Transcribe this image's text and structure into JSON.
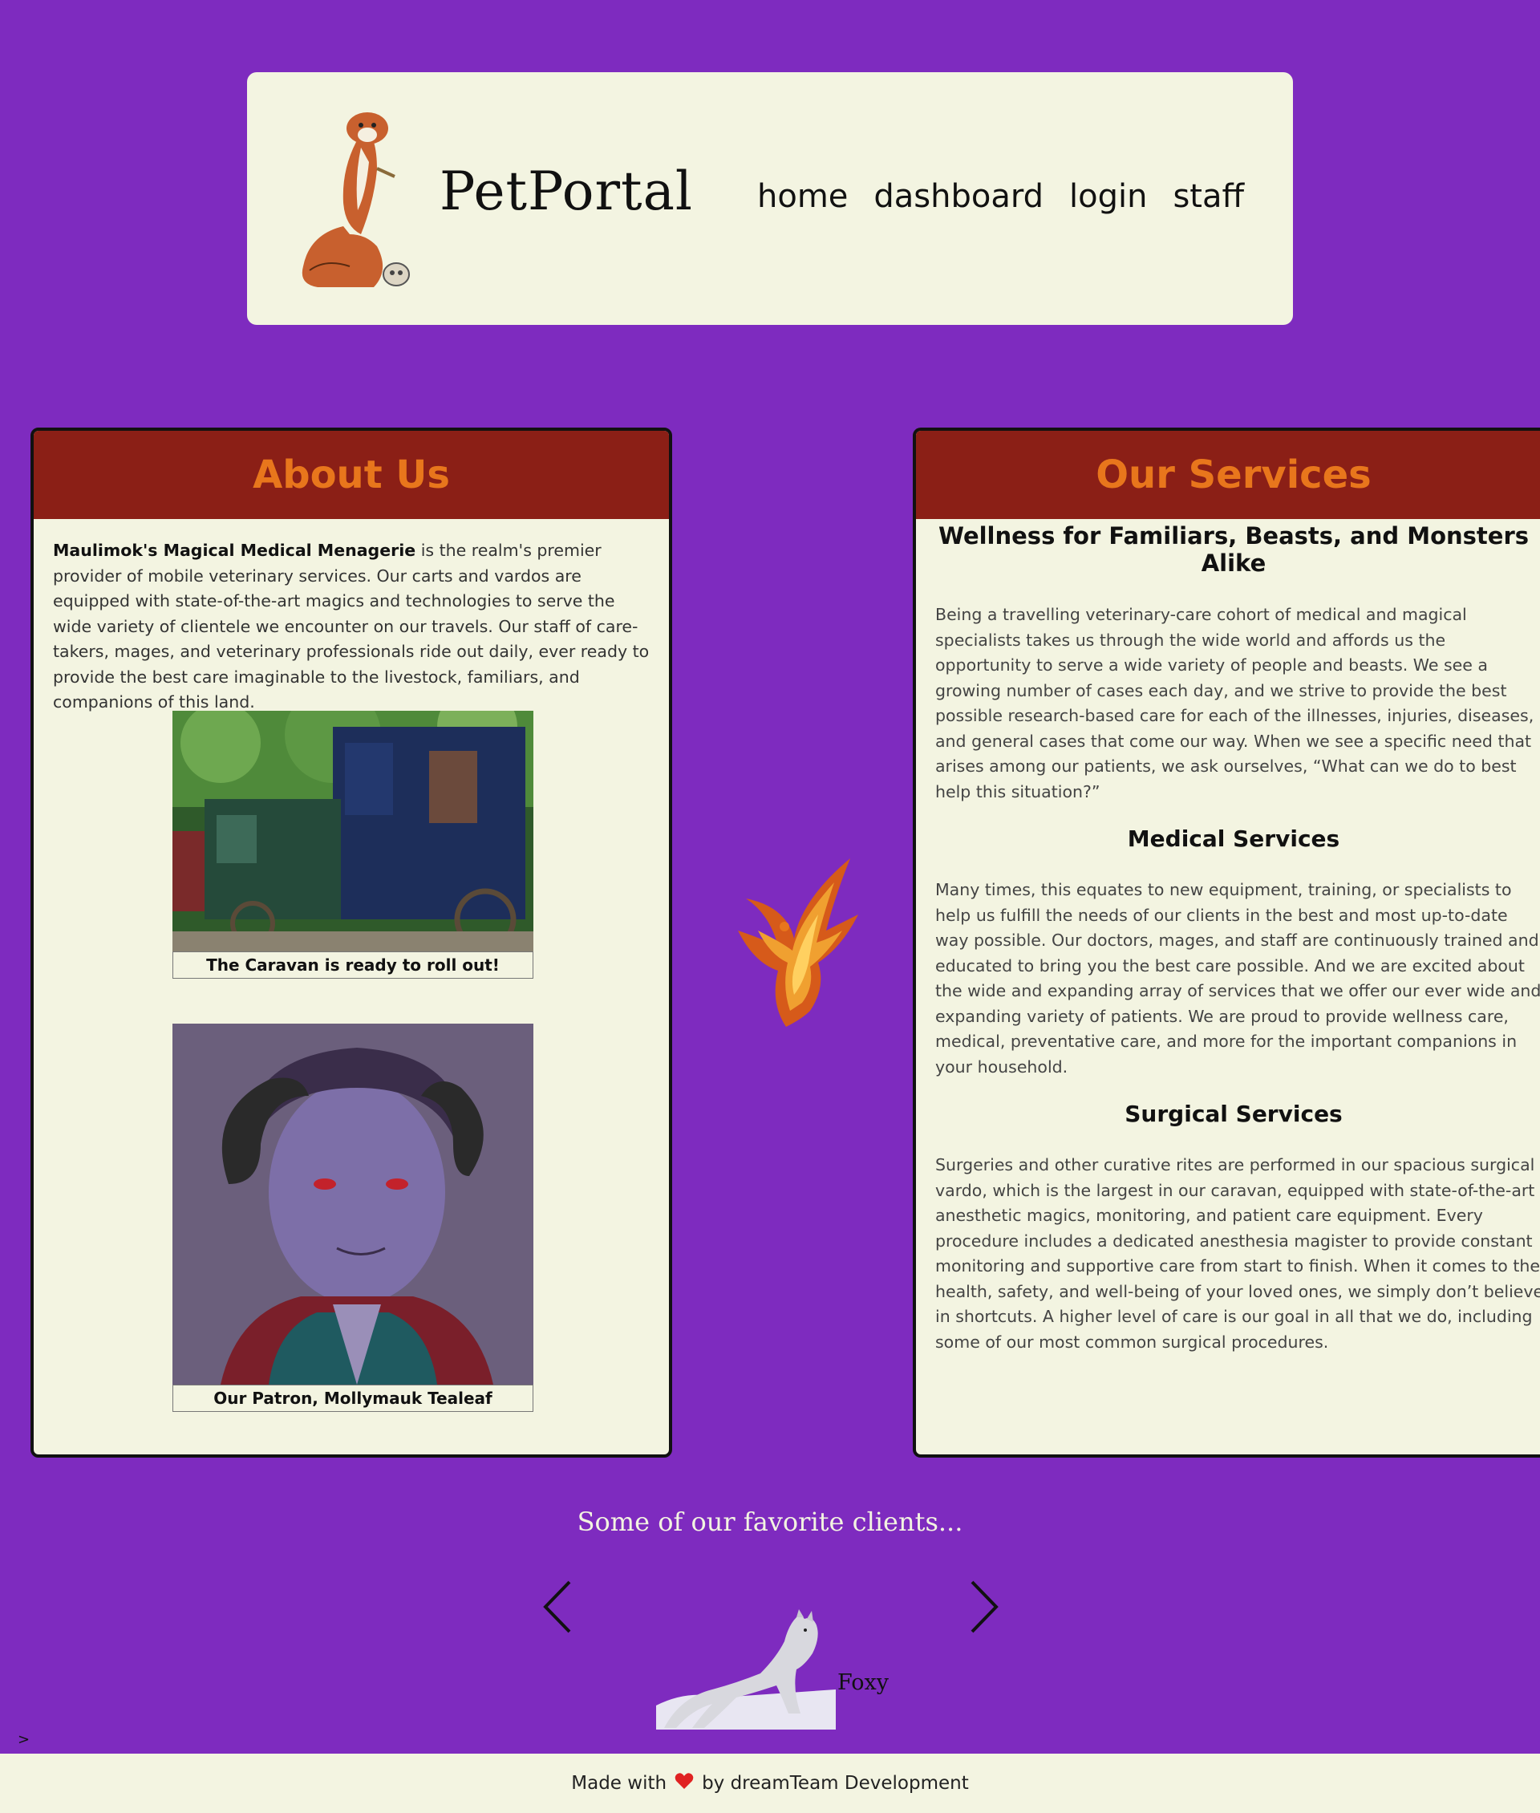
{
  "header": {
    "brand": "PetPortal",
    "logo_icon": "ferret-mascot-icon",
    "nav": [
      {
        "label": "home"
      },
      {
        "label": "dashboard"
      },
      {
        "label": "login"
      },
      {
        "label": "staff"
      }
    ]
  },
  "about": {
    "title": "About Us",
    "intro_bold": "Maulimok's Magical Medical Menagerie",
    "intro_rest": " is the realm's premier provider of mobile veterinary services. Our carts and vardos are equipped with state-of-the-art magics and technologies to serve the wide variety of clientele we encounter on our travels. Our staff of care-takers, mages, and veterinary professionals ride out daily, ever ready to provide the best care imaginable to the livestock, familiars, and companions of this land.",
    "figures": [
      {
        "caption": "The Caravan is ready to roll out!"
      },
      {
        "caption": "Our Patron, Mollymauk Tealeaf"
      }
    ]
  },
  "services": {
    "title": "Our Services",
    "subtitle": "Wellness for Familiars, Beasts, and Monsters Alike",
    "intro": "Being a travelling veterinary-care cohort of medical and magical specialists takes us through the wide world and affords us the opportunity to serve a wide variety of people and beasts. We see a growing number of cases each day, and we strive to provide the best possible research-based care for each of the illnesses, injuries, diseases, and general cases that come our way. When we see a specific need that arises among our patients, we ask ourselves, “What can we do to best help this situation?”",
    "medical_title": "Medical Services",
    "medical_text": "Many times, this equates to new equipment, training, or specialists to help us fulfill the needs of our clients in the best and most up-to-date way possible. Our doctors, mages, and staff are continuously trained and educated to bring you the best care possible. And we are excited about the wide and expanding array of services that we offer our ever wide and expanding variety of patients. We are proud to provide wellness care, medical, preventative care, and more for the important companions in your household.",
    "surgical_title": "Surgical Services",
    "surgical_text": "Surgeries and other curative rites are performed in our spacious surgical vardo, which is the largest in our caravan, equipped with state-of-the-art anesthetic magics, monitoring, and patient care equipment. Every procedure includes a dedicated anesthesia magister to provide constant monitoring and supportive care from start to finish. When it comes to the health, safety, and well-being of your loved ones, we simply don’t believe in shortcuts. A higher level of care is our goal in all that we do, including some of our most common surgical procedures."
  },
  "clients": {
    "heading": "Some of our favorite clients...",
    "current": {
      "name": "Foxy"
    },
    "prev_icon": "chevron-left-icon",
    "next_icon": "chevron-right-icon"
  },
  "misc": {
    "caret": ">"
  },
  "footer": {
    "made_with": "Made with",
    "heart_icon": "heart-icon",
    "by": "by dreamTeam Development"
  },
  "colors": {
    "background": "#7e2bbf",
    "panel": "#f3f4e1",
    "card_header": "#8b1f16",
    "card_title": "#e8761c"
  }
}
